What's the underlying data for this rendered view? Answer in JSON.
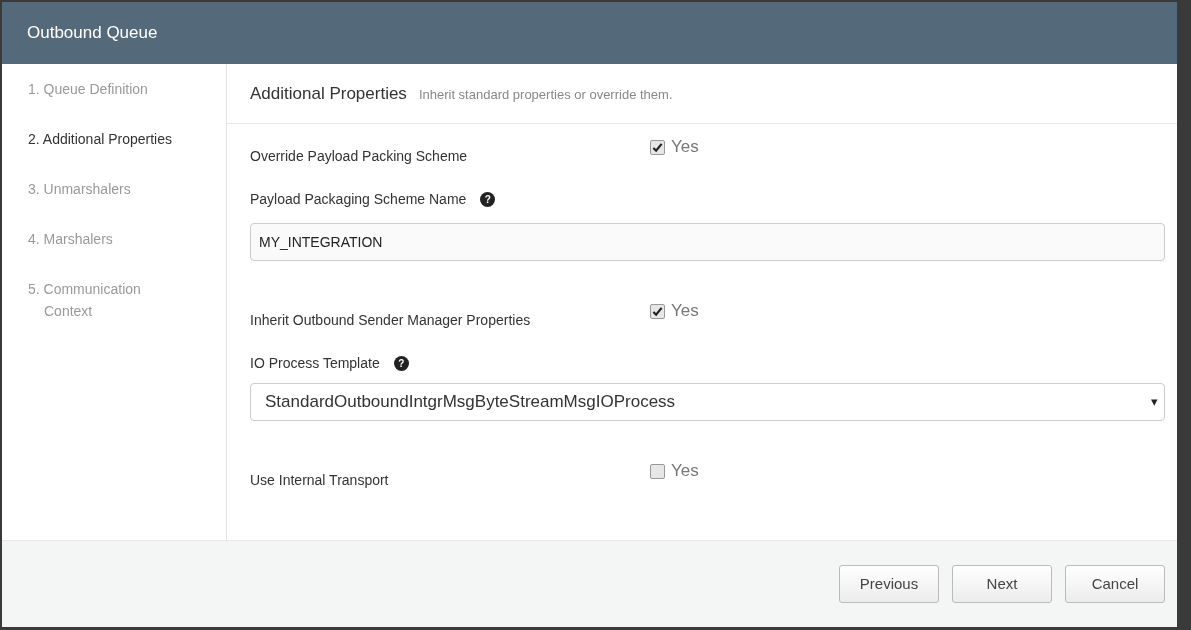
{
  "dialog": {
    "title": "Outbound Queue"
  },
  "steps": [
    {
      "label": "1. Queue Definition",
      "selected": false
    },
    {
      "label": "2. Additional Properties",
      "selected": true
    },
    {
      "label": "3. Unmarshalers",
      "selected": false
    },
    {
      "label": "4. Marshalers",
      "selected": false
    },
    {
      "label": "5. Communication Context",
      "selected": false
    }
  ],
  "section": {
    "title": "Additional Properties",
    "subtitle": "Inherit standard properties or override them."
  },
  "fields": [
    {
      "kind": "checkbox",
      "label": "Override Payload Packing Scheme",
      "option": "Yes",
      "checked": true
    },
    {
      "kind": "text",
      "label": "Payload Packaging Scheme Name",
      "help": "?",
      "value": "MY_INTEGRATION"
    },
    {
      "kind": "checkbox",
      "label": "Inherit Outbound Sender Manager Properties",
      "option": "Yes",
      "checked": true
    },
    {
      "kind": "select",
      "label": "IO Process Template",
      "help": "?",
      "value": "StandardOutboundIntgrMsgByteStreamMsgIOProcess",
      "arrow": "▾"
    },
    {
      "kind": "checkbox",
      "label": "Use Internal Transport",
      "option": "Yes",
      "checked": false
    }
  ],
  "buttons": [
    "Previous",
    "Next",
    "Cancel"
  ]
}
